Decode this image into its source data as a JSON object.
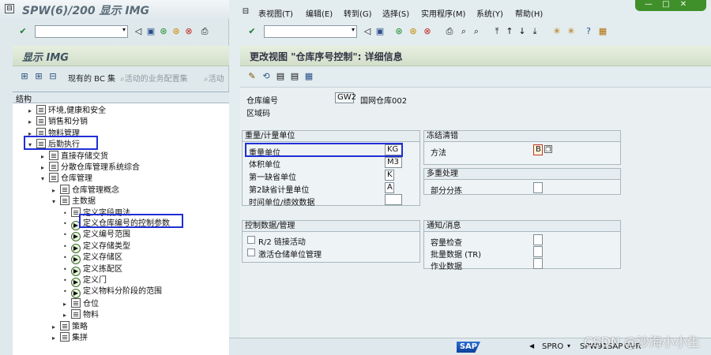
{
  "left_window": {
    "title": "SPW(6)/200 显示 IMG",
    "header_title": "显示 IMG",
    "app_toolbar": {
      "current_bc_set": "现有的 BC 集",
      "active_bc_set": "活动的业务配置集",
      "active_short": "活动"
    },
    "tree": {
      "header": "结构",
      "nodes": [
        {
          "label": "环境,健康和安全",
          "depth": 0,
          "arrow": "▸",
          "icon": "doc"
        },
        {
          "label": "销售和分销",
          "depth": 0,
          "arrow": "▸",
          "icon": "doc"
        },
        {
          "label": "物料管理",
          "depth": 0,
          "arrow": "▸",
          "icon": "doc"
        },
        {
          "label": "后勤执行",
          "depth": 0,
          "arrow": "▾",
          "icon": "doc"
        },
        {
          "label": "直接存储交货",
          "depth": 1,
          "arrow": "▸",
          "icon": "doc"
        },
        {
          "label": "分散仓库管理系统综合",
          "depth": 1,
          "arrow": "▸",
          "icon": "doc"
        },
        {
          "label": "仓库管理",
          "depth": 1,
          "arrow": "▾",
          "icon": "doc"
        },
        {
          "label": "仓库管理概念",
          "depth": 2,
          "arrow": "▸",
          "icon": "doc"
        },
        {
          "label": "主数据",
          "depth": 2,
          "arrow": "▾",
          "icon": "doc"
        },
        {
          "label": "定义字段用法",
          "depth": 3,
          "arrow": "•",
          "icon": "doc"
        },
        {
          "label": "定义仓库编号的控制参数",
          "depth": 3,
          "arrow": "•",
          "icon": "clock"
        },
        {
          "label": "定义编号范围",
          "depth": 3,
          "arrow": "•",
          "icon": "clock"
        },
        {
          "label": "定义存储类型",
          "depth": 3,
          "arrow": "•",
          "icon": "clock"
        },
        {
          "label": "定义存储区",
          "depth": 3,
          "arrow": "•",
          "icon": "clock"
        },
        {
          "label": "定义拣配区",
          "depth": 3,
          "arrow": "•",
          "icon": "clock"
        },
        {
          "label": "定义门",
          "depth": 3,
          "arrow": "•",
          "icon": "clock"
        },
        {
          "label": "定义物料分阶段的范围",
          "depth": 3,
          "arrow": "•",
          "icon": "clock"
        },
        {
          "label": "仓位",
          "depth": 3,
          "arrow": "▸",
          "icon": "doc"
        },
        {
          "label": "物料",
          "depth": 3,
          "arrow": "▸",
          "icon": "doc"
        },
        {
          "label": "策略",
          "depth": 2,
          "arrow": "▸",
          "icon": "doc"
        },
        {
          "label": "集拼",
          "depth": 2,
          "arrow": "▸",
          "icon": "doc"
        }
      ]
    }
  },
  "right_window": {
    "menu": [
      "表视图(T)",
      "编辑(E)",
      "转到(G)",
      "选择(S)",
      "实用程序(M)",
      "系统(Y)",
      "帮助(H)"
    ],
    "header_title": "更改视图 \"仓库序号控制\": 详细信息",
    "fields": {
      "warehouse_no_label": "仓库编号",
      "warehouse_no_value": "GW2",
      "warehouse_desc": "国网仓库002",
      "zone_label": "区域码"
    },
    "group_weight": {
      "title": "重量/计量单位",
      "rows": [
        {
          "label": "重量单位",
          "value": "KG"
        },
        {
          "label": "体积单位",
          "value": "M3"
        },
        {
          "label": "第一缺省单位",
          "value": "K"
        },
        {
          "label": "第2缺省计量单位",
          "value": "A"
        },
        {
          "label": "时间单位/绩效数据",
          "value": ""
        }
      ]
    },
    "group_freeze": {
      "title": "冻结清错",
      "method_label": "方法",
      "method_value": "B"
    },
    "group_multi": {
      "title": "多重处理",
      "partial_label": "部分分拣"
    },
    "group_control": {
      "title": "控制数据/管理",
      "r2_label": "R/2 链接活动",
      "activate_label": "激活仓储单位管理"
    },
    "group_notify": {
      "title": "通知/消息",
      "rows": [
        "容量检查",
        "批量数据 (TR)",
        "作业数据"
      ]
    },
    "status": {
      "sap": "SAP",
      "system": "SPRO",
      "server": "SPW91SAP",
      "mode": "OVR"
    }
  },
  "watermark": "CSDN @沙海小小生"
}
